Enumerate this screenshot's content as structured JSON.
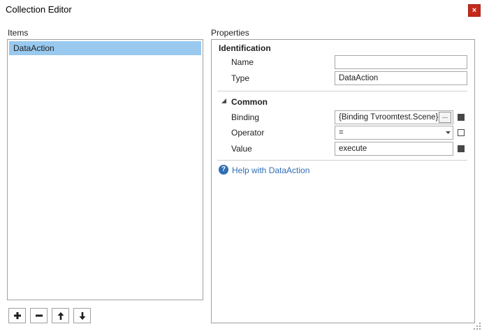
{
  "window": {
    "title": "Collection Editor",
    "close_glyph": "×"
  },
  "items_panel": {
    "label": "Items",
    "items": [
      "DataAction"
    ],
    "selected_index": 0,
    "buttons": [
      {
        "name": "add-item-button",
        "icon": "plus-icon"
      },
      {
        "name": "remove-item-button",
        "icon": "minus-icon"
      },
      {
        "name": "move-up-button",
        "icon": "arrow-up-icon"
      },
      {
        "name": "move-down-button",
        "icon": "arrow-down-icon"
      }
    ]
  },
  "properties_panel": {
    "label": "Properties",
    "identification": {
      "header": "Identification",
      "name_label": "Name",
      "name_value": "",
      "type_label": "Type",
      "type_value": "DataAction"
    },
    "common": {
      "header": "Common",
      "expanded": true,
      "binding_label": "Binding",
      "binding_value": "{Binding Tvroomtest.Scene}",
      "binding_button": "...",
      "operator_label": "Operator",
      "operator_value": "=",
      "value_label": "Value",
      "value_value": "execute"
    },
    "help": {
      "icon_glyph": "?",
      "text": "Help with DataAction"
    }
  },
  "colors": {
    "selection": "#99c9ef",
    "close": "#c42b1c",
    "link": "#2f6fb5",
    "marker": "#474747"
  }
}
